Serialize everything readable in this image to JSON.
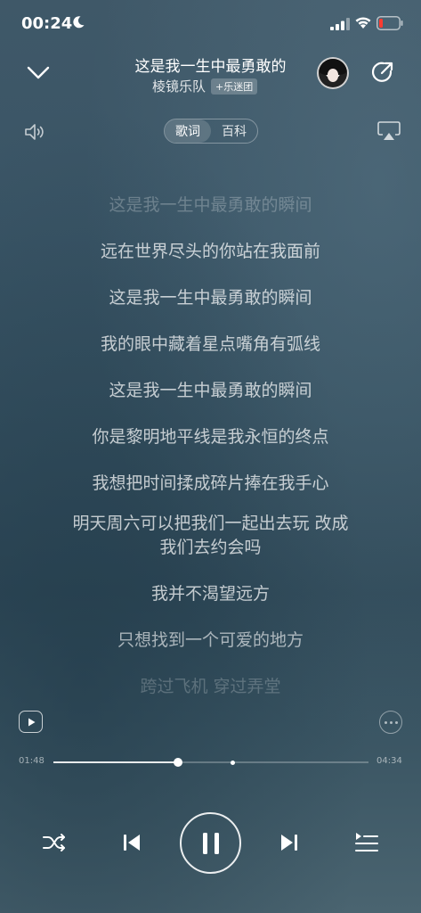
{
  "status": {
    "time": "00:24"
  },
  "header": {
    "title": "这是我一生中最勇敢的",
    "artist": "棱镜乐队",
    "fan_badge": "+乐迷团"
  },
  "tabs": [
    {
      "label": "歌词",
      "active": true
    },
    {
      "label": "百科",
      "active": false
    }
  ],
  "lyrics": [
    {
      "text": "这是我一生中最勇敢的瞬间",
      "opacity": 0.25
    },
    {
      "text": "远在世界尽头的你站在我面前",
      "opacity": 0.72
    },
    {
      "text": "这是我一生中最勇敢的瞬间",
      "opacity": 0.72
    },
    {
      "text": "我的眼中藏着星点嘴角有弧线",
      "opacity": 0.72
    },
    {
      "text": "这是我一生中最勇敢的瞬间",
      "opacity": 0.72
    },
    {
      "text": "你是黎明地平线是我永恒的终点",
      "opacity": 0.72
    },
    {
      "text": "我想把时间揉成碎片捧在我手心",
      "opacity": 0.72
    },
    {
      "text": "明天周六可以把我们一起出去玩 改成",
      "opacity": 0.72
    },
    {
      "text": "我们去约会吗",
      "opacity": 0.72
    },
    {
      "text": "我并不渴望远方",
      "opacity": 0.72
    },
    {
      "text": "只想找到一个可爱的地方",
      "opacity": 0.6
    },
    {
      "text": "跨过飞机 穿过弄堂",
      "opacity": 0.22
    }
  ],
  "player": {
    "current_time": "01:48",
    "total_time": "04:34",
    "progress": 0.395,
    "marker": 0.57,
    "state": "playing"
  },
  "icons": {
    "collapse": "chevron-down-icon",
    "share": "share-icon",
    "volume": "speaker-icon",
    "cast": "airplay-icon",
    "shuffle": "shuffle-icon",
    "prev": "previous-icon",
    "pause": "pause-icon",
    "next": "next-icon",
    "playlist": "playlist-icon"
  }
}
